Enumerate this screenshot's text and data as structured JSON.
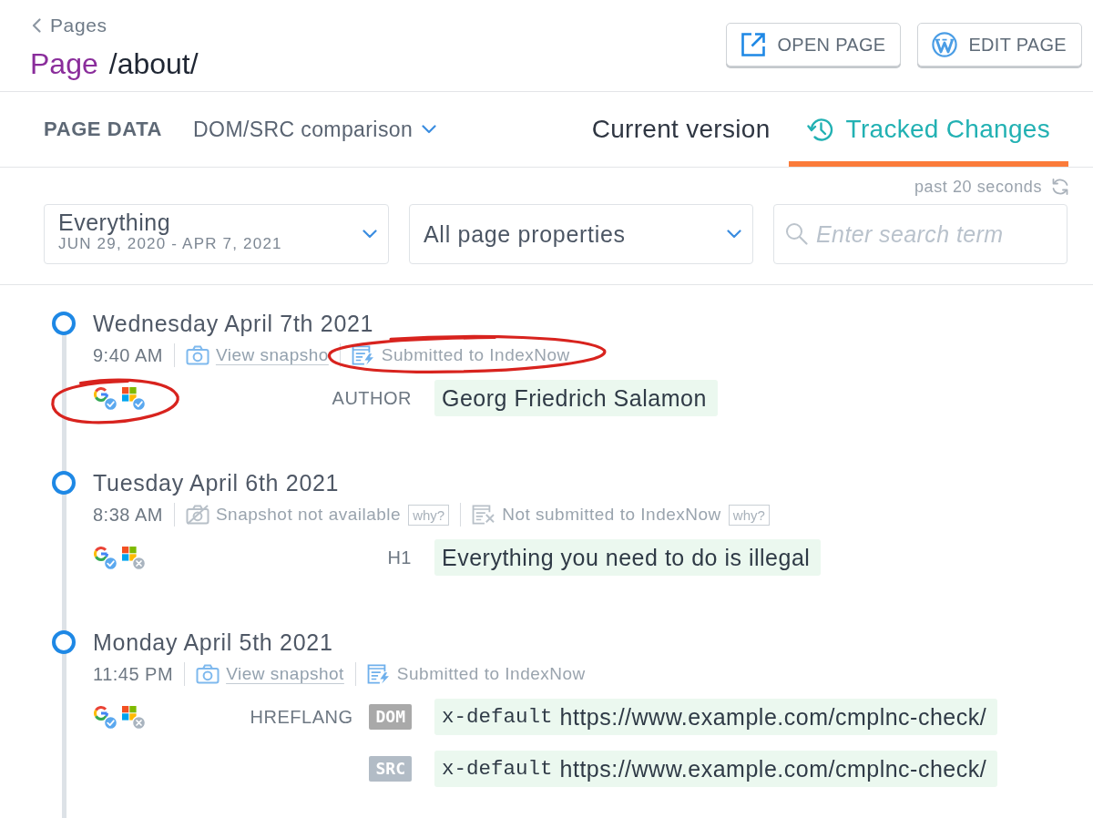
{
  "breadcrumb": {
    "label": "Pages"
  },
  "page": {
    "type_label": "Page",
    "path": "/about/"
  },
  "actions": [
    {
      "kind": "external-link",
      "label": "OPEN PAGE"
    },
    {
      "kind": "wordpress",
      "label": "EDIT PAGE"
    }
  ],
  "section_label": "PAGE DATA",
  "view_selector": {
    "label": "DOM/SRC comparison"
  },
  "tabs": [
    {
      "kind": "plain",
      "label": "Current version",
      "selected": false
    },
    {
      "kind": "history",
      "label": "Tracked Changes",
      "selected": true
    }
  ],
  "refresh": {
    "label": "past 20 seconds"
  },
  "filters": {
    "period": {
      "value": "Everything",
      "range": "JUN 29, 2020 - APR 7, 2021"
    },
    "properties": {
      "value": "All page properties"
    },
    "search": {
      "placeholder": "Enter search term"
    }
  },
  "timeline": [
    {
      "date": "Wednesday April 7th 2021",
      "time": "9:40 AM",
      "snapshot": {
        "available": true,
        "label": "View snapsho"
      },
      "indexnow": {
        "submitted": true,
        "label": "Submitted to IndexNow",
        "circled": true
      },
      "engines": {
        "circled": true,
        "items": [
          {
            "kind": "google",
            "notified": true
          },
          {
            "kind": "microsoft",
            "notified": true
          }
        ]
      },
      "changes": [
        {
          "property": "AUTHOR",
          "values": [
            {
              "text": "Georg Friedrich Salamon"
            }
          ]
        }
      ]
    },
    {
      "date": "Tuesday April 6th 2021",
      "time": "8:38 AM",
      "snapshot": {
        "available": false,
        "label": "Snapshot not available",
        "hint": "why?"
      },
      "indexnow": {
        "submitted": false,
        "label": "Not submitted to IndexNow",
        "hint": "why?",
        "circled": false
      },
      "engines": {
        "circled": false,
        "items": [
          {
            "kind": "google",
            "notified": true
          },
          {
            "kind": "microsoft",
            "notified": false
          }
        ]
      },
      "changes": [
        {
          "property": "H1",
          "values": [
            {
              "text": "Everything you need to do is illegal"
            }
          ]
        }
      ]
    },
    {
      "date": "Monday April 5th 2021",
      "time": "11:45 PM",
      "snapshot": {
        "available": true,
        "label": "View snapshot"
      },
      "indexnow": {
        "submitted": true,
        "label": "Submitted to IndexNow",
        "circled": false
      },
      "engines": {
        "circled": false,
        "items": [
          {
            "kind": "google",
            "notified": true
          },
          {
            "kind": "microsoft",
            "notified": false
          }
        ]
      },
      "changes": [
        {
          "property": "HREFLANG",
          "values": [
            {
              "source": "DOM",
              "kind": "dom",
              "code": "x-default",
              "text": "https://www.example.com/cmplnc-check/"
            },
            {
              "source": "SRC",
              "kind": "src",
              "code": "x-default",
              "text": "https://www.example.com/cmplnc-check/"
            }
          ]
        }
      ]
    }
  ]
}
